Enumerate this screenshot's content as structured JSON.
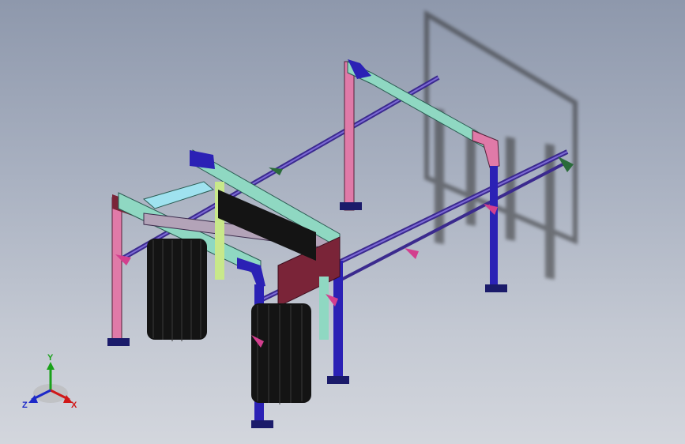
{
  "viewport": {
    "background_top": "#8e98ac",
    "background_bottom": "#d3d6dd"
  },
  "model": {
    "frame_color": "#2b21b5",
    "post_color": "#e07aa8",
    "beam_color": "#8fd8c2",
    "brush_color": "#141414",
    "rail_color": "#3b2a8e",
    "motor_box_color": "#7a2438"
  },
  "triad": {
    "x_label": "X",
    "y_label": "Y",
    "z_label": "Z",
    "x_color": "#d01818",
    "y_color": "#1aa11a",
    "z_color": "#1c28c8"
  }
}
